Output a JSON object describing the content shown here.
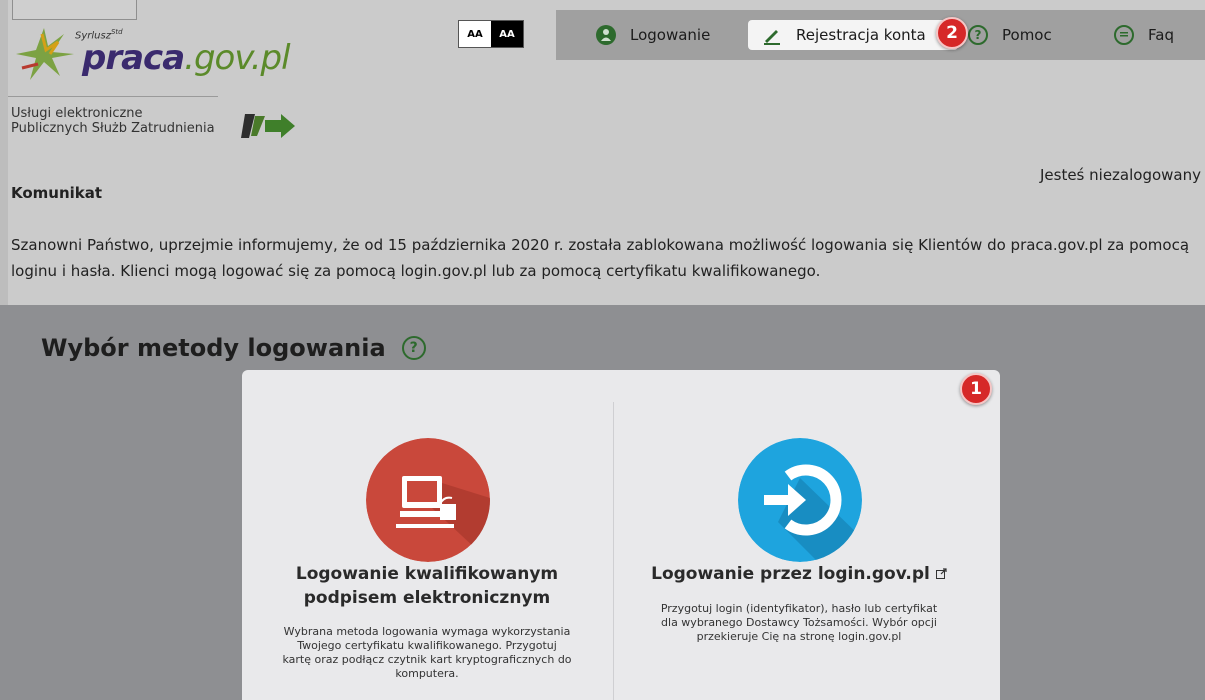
{
  "header": {
    "logo_small": "Syrlusz",
    "logo_sup": "Std",
    "logo_main": "praca",
    "logo_domain": ".gov.pl",
    "services_line1": "Usługi elektroniczne",
    "services_line2": "Publicznych Służb Zatrudnienia",
    "contrast_normal": "AA",
    "contrast_high": "AA"
  },
  "nav": {
    "login": "Logowanie",
    "register": "Rejestracja konta",
    "help": "Pomoc",
    "faq": "Faq"
  },
  "badges": {
    "nav_badge": "2",
    "card_badge": "1"
  },
  "status": {
    "not_logged_in": "Jesteś niezalogowany"
  },
  "notice": {
    "title": "Komunikat",
    "text": "Szanowni Państwo, uprzejmie informujemy, że od 15 października 2020 r. została zablokowana możliwość logowania się Klientów do praca.gov.pl za pomocą loginu i hasła. Klienci mogą logować się za pomocą login.gov.pl lub za pomocą certyfikatu kwalifikowanego."
  },
  "login_methods": {
    "title": "Wybór metody logowania",
    "help_icon": "?",
    "options": [
      {
        "icon": "computer-card-reader-icon",
        "title": "Logowanie kwalifikowanym podpisem elektronicznym",
        "description": "Wybrana metoda logowania wymaga wykorzystania Twojego certyfikatu kwalifikowanego. Przygotuj kartę oraz podłącz czytnik kart kryptograficznych do komputera."
      },
      {
        "icon": "login-arrow-icon",
        "title": "Logowanie przez login.gov.pl",
        "description": "Przygotuj login (identyfikator), hasło lub certyfikat dla wybranego Dostawcy Tożsamości. Wybór opcji przekieruje Cię na stronę login.gov.pl"
      }
    ]
  },
  "colors": {
    "brand_green": "#2d6a2d",
    "badge_red": "#d62828",
    "login_gov_blue": "#1ea4de",
    "qualified_red": "#c9483b"
  }
}
